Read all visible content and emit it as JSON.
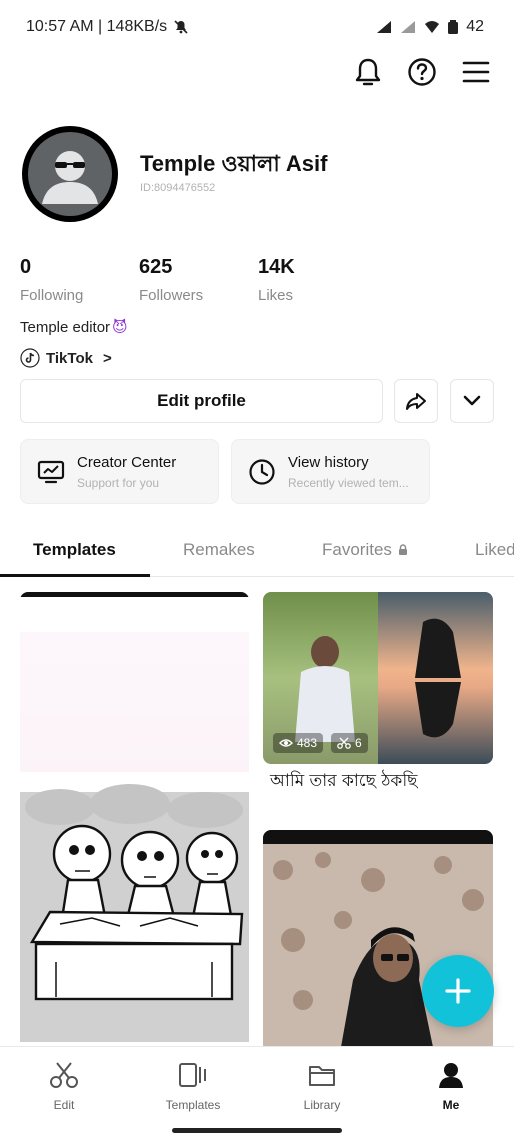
{
  "status": {
    "time_speed": "10:57 AM | 148KB/s",
    "battery": "42"
  },
  "header_icons": [
    "bell-icon",
    "help-icon",
    "menu-icon"
  ],
  "profile": {
    "name": "Temple ওয়ালা Asif",
    "id": "ID:8094476552",
    "bio": "Temple editor",
    "bio_emoji": "😈",
    "tiktok_label": "TikTok",
    "tiktok_chevron": ">"
  },
  "stats": [
    {
      "value": "0",
      "label": "Following"
    },
    {
      "value": "625",
      "label": "Followers"
    },
    {
      "value": "14K",
      "label": "Likes"
    }
  ],
  "buttons": {
    "edit_profile": "Edit profile"
  },
  "cards": [
    {
      "title": "Creator Center",
      "subtitle": "Support for you"
    },
    {
      "title": "View history",
      "subtitle": "Recently viewed tem..."
    }
  ],
  "tabs": [
    {
      "label": "Templates",
      "active": true
    },
    {
      "label": "Remakes",
      "active": false
    },
    {
      "label": "Favorites",
      "active": false
    },
    {
      "label": "Liked",
      "active": false
    }
  ],
  "templates": [
    {
      "caption": "",
      "views": "",
      "uses": ""
    },
    {
      "caption": "আমি তার কাছে ঠকছি",
      "views": "483",
      "uses": "6"
    },
    {
      "caption": "",
      "views": "",
      "uses": ""
    }
  ],
  "fab_label": "+",
  "bottom_nav": [
    {
      "label": "Edit",
      "icon": "scissors-icon"
    },
    {
      "label": "Templates",
      "icon": "templates-icon"
    },
    {
      "label": "Library",
      "icon": "folder-icon"
    },
    {
      "label": "Me",
      "icon": "person-icon",
      "active": true
    }
  ],
  "colors": {
    "accent": "#12c2d9",
    "text": "#111111",
    "muted": "#8a8a8a"
  }
}
